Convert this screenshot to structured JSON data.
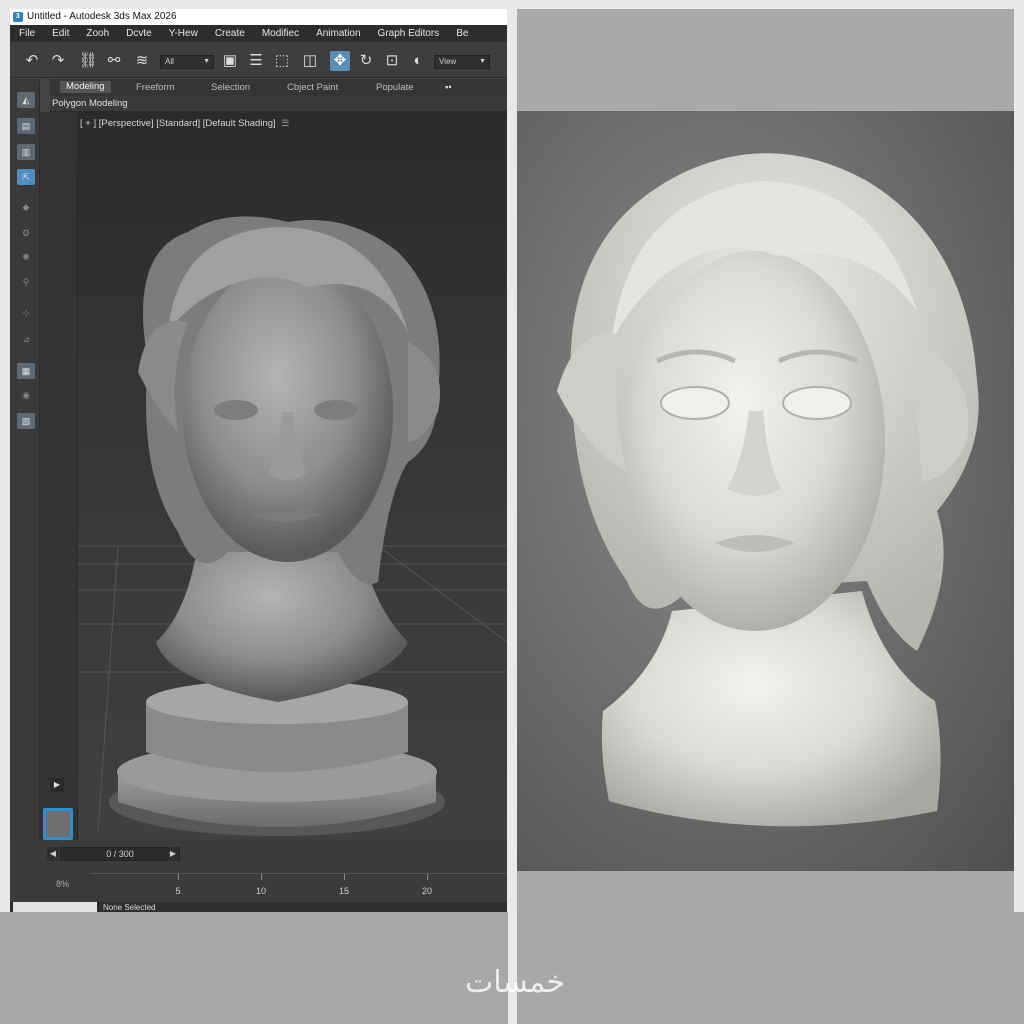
{
  "window": {
    "title": "Untitled - Autodesk 3ds Max 2026"
  },
  "menu": [
    "File",
    "Edit",
    "Zooh",
    "Dcvte",
    "Y-Hew",
    "Create",
    "Modifiec",
    "Animation",
    "Graph Editors",
    "Be"
  ],
  "toolbar": {
    "selection_filter": "All",
    "reference_coord": "View",
    "icons": [
      "undo-icon",
      "redo-icon",
      "link-icon",
      "unlink-icon",
      "bind-spacewarp-icon",
      "select-object-icon",
      "select-by-name-icon",
      "rect-selection-icon",
      "window-crossing-icon",
      "move-icon",
      "rotate-icon",
      "scale-icon",
      "snap-icon"
    ]
  },
  "ribbon": {
    "tabs": [
      "Modeling",
      "Freeform",
      "Selection",
      "Cbject Paint",
      "Populate"
    ],
    "active_tab": "Modeling",
    "panel_label": "Polygon Modeling"
  },
  "viewport": {
    "label": "[ + ] [Perspective] [Standard] [Default Shading]"
  },
  "timeline": {
    "frame_display": "0 / 300",
    "ticks": [
      "5",
      "10",
      "15",
      "20"
    ],
    "percent_label": "8%"
  },
  "status": {
    "selection_text": "None Selected"
  },
  "watermark": "خمسات",
  "colors": {
    "accent": "#4f8cc0",
    "viewport_bg": "#333333",
    "model": "#8e8e8e",
    "marble": "#e8e6e1"
  }
}
